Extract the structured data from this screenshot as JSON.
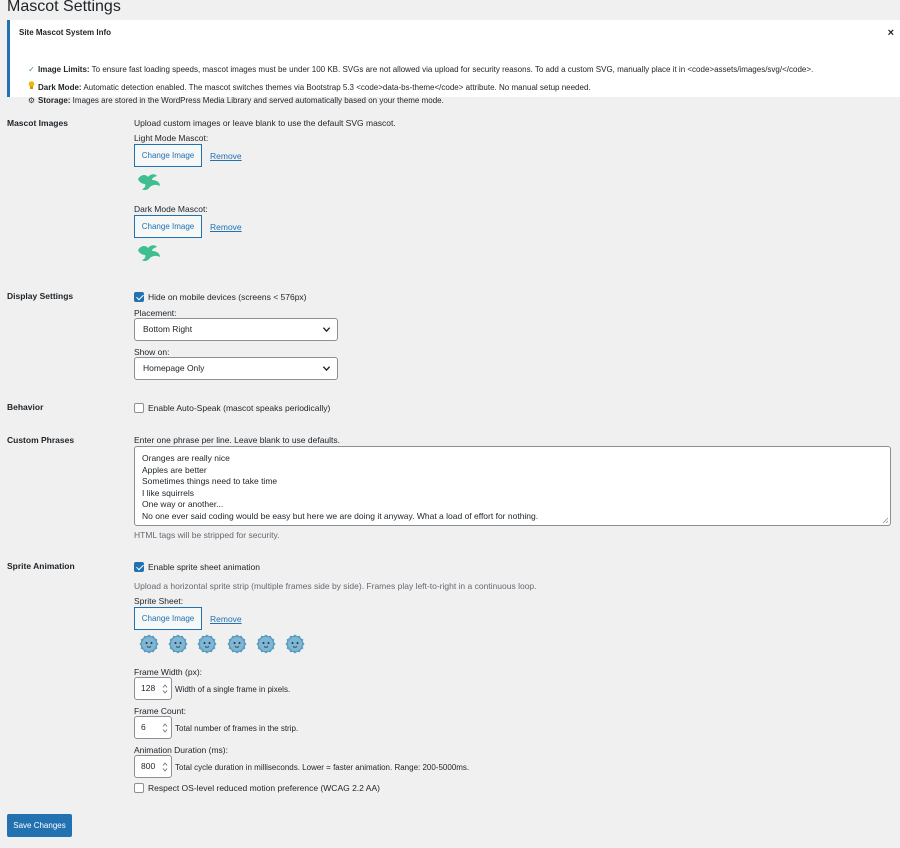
{
  "page": {
    "title": "Mascot Settings"
  },
  "notice": {
    "title": "Site Mascot System Info",
    "close_glyph": "×",
    "items": [
      {
        "icon": "check-icon",
        "glyph": "✓",
        "label": "Image Limits:",
        "text": " To ensure fast loading speeds, mascot images must be under 100 KB. SVGs are not allowed via upload for security reasons. To add a custom SVG, manually place it in <code>assets/images/svg/</code>."
      },
      {
        "icon": "lightbulb-icon",
        "glyph": "💡",
        "label": "Dark Mode:",
        "text": " Automatic detection enabled. The mascot switches themes via Bootstrap 5.3 <code>data-bs-theme</code> attribute. No manual setup needed."
      },
      {
        "icon": "gear-icon",
        "glyph": "⚙",
        "label": "Storage:",
        "text": " Images are stored in the WordPress Media Library and served automatically based on your theme mode."
      }
    ]
  },
  "mascot_images": {
    "label": "Mascot Images",
    "description": "Upload custom images or leave blank to use the default SVG mascot.",
    "light_label": "Light Mode Mascot:",
    "dark_label": "Dark Mode Mascot:",
    "change_label": "Change Image",
    "remove_label": "Remove",
    "mascot_color": "#3fbf8f"
  },
  "display_settings": {
    "label": "Display Settings",
    "hide_mobile_label": "Hide on mobile devices (screens < 576px)",
    "hide_mobile_checked": true,
    "placement_label": "Placement:",
    "placement_value": "Bottom Right",
    "show_on_label": "Show on:",
    "show_on_value": "Homepage Only"
  },
  "behavior": {
    "label": "Behavior",
    "auto_speak_label": "Enable Auto-Speak (mascot speaks periodically)",
    "auto_speak_checked": false
  },
  "custom_phrases": {
    "label": "Custom Phrases",
    "description": "Enter one phrase per line. Leave blank to use defaults.",
    "lines": [
      "Oranges are really nice",
      "Apples are better",
      "Sometimes things need to take time",
      "I like squirrels",
      "One way or another...",
      "No one ever said coding would be easy but here we are doing it anyway. What a load of effort for nothing."
    ],
    "help": "HTML tags will be stripped for security."
  },
  "sprite_animation": {
    "label": "Sprite Animation",
    "enable_label": "Enable sprite sheet animation",
    "enable_checked": true,
    "description": "Upload a horizontal sprite strip (multiple frames side by side). Frames play left-to-right in a continuous loop.",
    "sheet_label": "Sprite Sheet:",
    "change_label": "Change Image",
    "remove_label": "Remove",
    "frame_color": "#5b9dbf",
    "frame_width_label": "Frame Width (px):",
    "frame_width_value": "128",
    "frame_width_help": "Width of a single frame in pixels.",
    "frame_count_label": "Frame Count:",
    "frame_count_value": "6",
    "frame_count_help": "Total number of frames in the strip.",
    "duration_label": "Animation Duration (ms):",
    "duration_value": "800",
    "duration_help": "Total cycle duration in milliseconds. Lower = faster animation. Range: 200-5000ms.",
    "reduced_motion_label": "Respect OS-level reduced motion preference (WCAG 2.2 AA)",
    "reduced_motion_checked": false
  },
  "actions": {
    "save_label": "Save Changes"
  },
  "colors": {
    "accent": "#2271b1",
    "notice_border": "#2271b1",
    "background": "#f0f0f1"
  }
}
